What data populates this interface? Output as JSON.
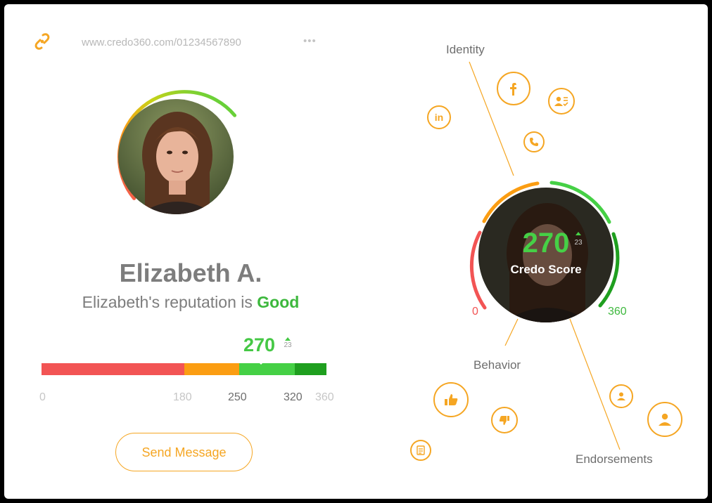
{
  "header": {
    "url": "www.credo360.com/01234567890",
    "more_label": "•••",
    "logo_icon": "credo-link-logo",
    "more_icon": "ellipsis-icon"
  },
  "profile": {
    "name": "Elizabeth A.",
    "reputation_prefix": "Elizabeth's reputation is",
    "reputation_value": "Good",
    "ring_progress": 0.75
  },
  "score_bar": {
    "score": "270",
    "delta": "23",
    "min": 0,
    "max": 360,
    "ticks": [
      "0",
      "180",
      "250",
      "320",
      "360"
    ],
    "segments": [
      {
        "from": 0,
        "to": 180,
        "color": "#f25454"
      },
      {
        "from": 180,
        "to": 250,
        "color": "#fb9d12"
      },
      {
        "from": 250,
        "to": 320,
        "color": "#45d045"
      },
      {
        "from": 320,
        "to": 360,
        "color": "#1f9f1f"
      }
    ]
  },
  "actions": {
    "send_message": "Send Message"
  },
  "credo_graph": {
    "score": "270",
    "delta": "23",
    "score_label": "Credo Score",
    "range_min": "0",
    "range_max": "360",
    "categories": {
      "identity": "Identity",
      "behavior": "Behavior",
      "endorsements": "Endorsements"
    },
    "identity_icons": [
      "linkedin-icon",
      "facebook-icon",
      "user-verified-icon",
      "phone-icon"
    ],
    "behavior_icons": [
      "thumbs-up-icon",
      "thumbs-down-icon",
      "document-icon"
    ],
    "endorsement_icons": [
      "user-icon-small",
      "user-icon-large"
    ]
  },
  "colors": {
    "accent": "#f5a623",
    "good": "#3db83d",
    "bad": "#f25454",
    "warn": "#fb9d12",
    "great": "#1f9f1f"
  }
}
